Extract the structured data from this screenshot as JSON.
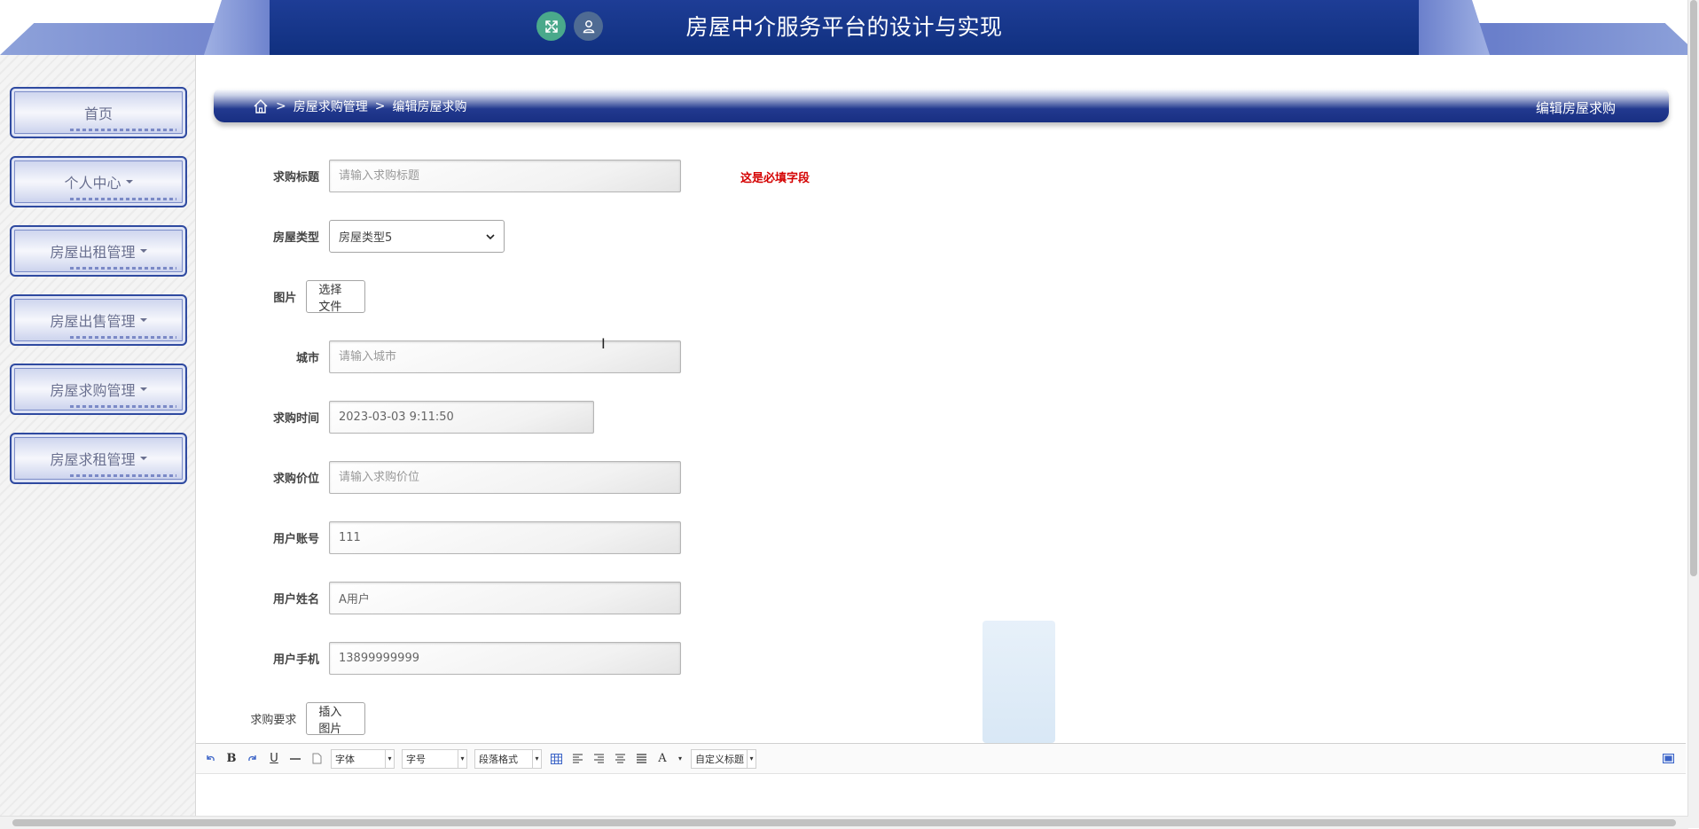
{
  "header": {
    "title": "房屋中介服务平台的设计与实现",
    "expand_icon": "expand-arrows-icon",
    "user_icon": "user-icon",
    "colors": {
      "primary": "#10307f",
      "expand_bg": "#4aa98b",
      "user_bg": "#4f6b93"
    }
  },
  "sidebar": {
    "items": [
      {
        "label": "首页",
        "has_caret": false
      },
      {
        "label": "个人中心",
        "has_caret": true
      },
      {
        "label": "房屋出租管理",
        "has_caret": true
      },
      {
        "label": "房屋出售管理",
        "has_caret": true
      },
      {
        "label": "房屋求购管理",
        "has_caret": true
      },
      {
        "label": "房屋求租管理",
        "has_caret": true
      }
    ]
  },
  "breadcrumb": {
    "home_icon": "home-icon",
    "separator": ">",
    "level1": "房屋求购管理",
    "level2": "编辑房屋求购",
    "right_title": "编辑房屋求购"
  },
  "form": {
    "fields": {
      "title": {
        "label": "求购标题",
        "value": "",
        "placeholder": "请输入求购标题"
      },
      "type": {
        "label": "房屋类型",
        "value": "房屋类型5"
      },
      "image": {
        "label": "图片",
        "button": "选择文件"
      },
      "city": {
        "label": "城市",
        "value": "",
        "placeholder": "请输入城市"
      },
      "time": {
        "label": "求购时间",
        "value": "2023-03-03 9:11:50"
      },
      "price": {
        "label": "求购价位",
        "value": "",
        "placeholder": "请输入求购价位"
      },
      "account": {
        "label": "用户账号",
        "value": "111"
      },
      "name": {
        "label": "用户姓名",
        "value": "A用户"
      },
      "phone": {
        "label": "用户手机",
        "value": "13899999999"
      },
      "requirement": {
        "label": "求购要求",
        "button": "插入图片"
      }
    },
    "required_msg": "这是必填字段",
    "required_color": "#d40000"
  },
  "editor": {
    "font_label": "字体",
    "size_label": "字号",
    "format_label": "段落格式",
    "custom_title_label": "自定义标题",
    "bold": "B",
    "underline": "U",
    "font_color": "A"
  }
}
